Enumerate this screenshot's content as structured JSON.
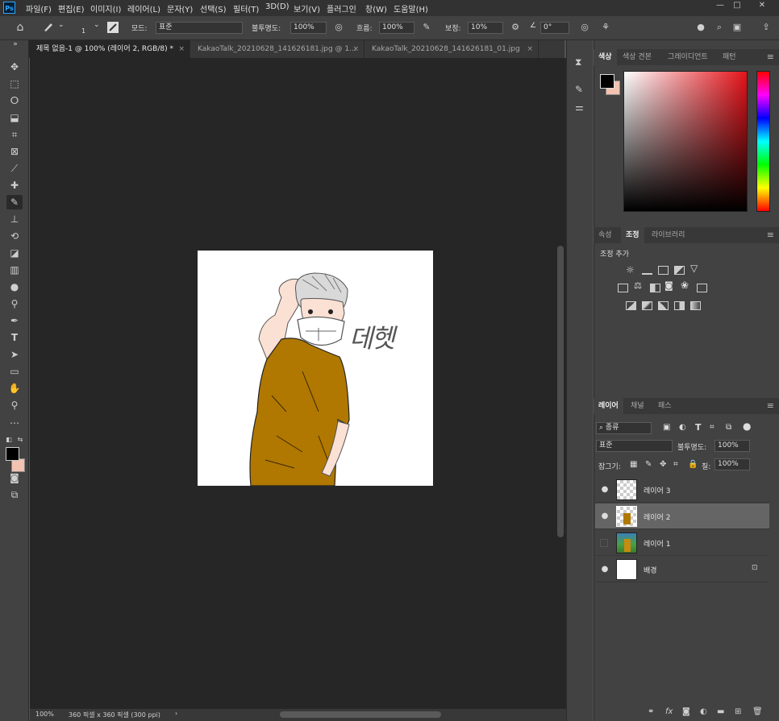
{
  "app": {
    "logo": "Ps"
  },
  "menu": [
    "파일(F)",
    "편집(E)",
    "이미지(I)",
    "레이어(L)",
    "문자(Y)",
    "선택(S)",
    "필터(T)",
    "3D(D)",
    "보기(V)",
    "플러그인",
    "창(W)",
    "도움말(H)"
  ],
  "window_controls": {
    "minimize": "—",
    "restore": "□",
    "close": "✕"
  },
  "options": {
    "brush_size": "1",
    "mode_label": "모드:",
    "mode_value": "표준",
    "opacity_label": "불투명도:",
    "opacity_value": "100%",
    "flow_label": "흐름:",
    "flow_value": "100%",
    "smoothing_label": "보정:",
    "smoothing_value": "10%",
    "angle_value": "0°"
  },
  "tabs": [
    {
      "label": "제목 없음-1 @ 100% (레이어 2, RGB/8) *",
      "close": "×"
    },
    {
      "label": "KakaoTalk_20210628_141626181.jpg @ 1...",
      "close": "×"
    },
    {
      "label": "KakaoTalk_20210628_141626181_01.jpg",
      "close": "×"
    }
  ],
  "artwork": {
    "signature": "데헷"
  },
  "status": {
    "zoom": "100%",
    "doc_info": "360 픽셀 x 360 픽셀 (300 ppi)",
    "arrow": "›"
  },
  "color_panel": {
    "tabs": [
      "색상",
      "색상 견본",
      "그레이디언트",
      "패턴"
    ]
  },
  "adjust_panel": {
    "tabs": [
      "속성",
      "조정",
      "라이브러리"
    ],
    "add_label": "조정 추가"
  },
  "layers_panel": {
    "tabs": [
      "레이어",
      "채널",
      "패스"
    ],
    "filter_label": "종류",
    "blend_mode": "표준",
    "opacity_label": "불투명도:",
    "opacity_value": "100%",
    "lock_label": "잠그기:",
    "fill_label": "칠:",
    "fill_value": "100%",
    "layers": [
      {
        "name": "레이어 3",
        "visible": true,
        "selected": false
      },
      {
        "name": "레이어 2",
        "visible": true,
        "selected": true
      },
      {
        "name": "레이어 1",
        "visible": false,
        "selected": false
      },
      {
        "name": "배경",
        "visible": true,
        "selected": false,
        "locked": true
      }
    ]
  },
  "colors": {
    "foreground": "#000000",
    "background": "#f4c2b0",
    "shirt": "#b07800",
    "accent": "#31a8ff"
  },
  "icons": {
    "panel_menu": "≡",
    "home": "⌂",
    "eye": "●",
    "lock": "🔒",
    "collapse": "»"
  }
}
